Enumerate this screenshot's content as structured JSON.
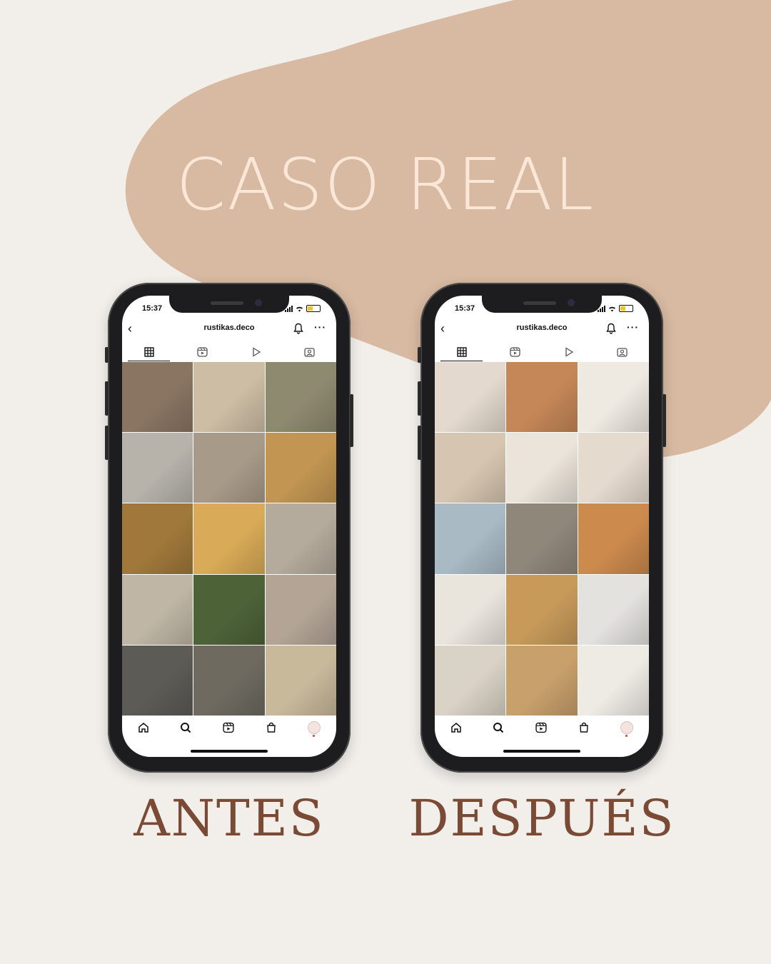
{
  "headline": "CASO REAL",
  "colors": {
    "background": "#f2efeb",
    "blob": "#d8b9a1",
    "headline": "#fbe7d8",
    "label": "#7a4a35"
  },
  "phones": [
    {
      "caption": "ANTES",
      "status_time": "15:37",
      "profile_name": "rustikas.deco",
      "icons": [
        "back-icon",
        "bell-icon",
        "more-icon",
        "grid-icon",
        "reels-icon",
        "play-icon",
        "tagged-icon",
        "home-icon",
        "search-icon",
        "reels-icon",
        "shop-icon",
        "profile-avatar"
      ],
      "tiles": [
        "#8a7563",
        "#cdbda4",
        "#8e8a70",
        "#b7b3ab",
        "#a89a88",
        "#c29652",
        "#a0783b",
        "#d9ab58",
        "#b5ab9c",
        "#bfb6a5",
        "#4e6238",
        "#b3a496",
        "#5c5b56",
        "#6e6a60",
        "#c9b99b"
      ]
    },
    {
      "caption": "DESPUÉS",
      "status_time": "15:37",
      "profile_name": "rustikas.deco",
      "icons": [
        "back-icon",
        "bell-icon",
        "more-icon",
        "grid-icon",
        "reels-icon",
        "play-icon",
        "tagged-icon",
        "home-icon",
        "search-icon",
        "reels-icon",
        "shop-icon",
        "profile-avatar"
      ],
      "tiles": [
        "#e3d9ce",
        "#c58758",
        "#eee9e1",
        "#d6c5b0",
        "#eae4da",
        "#e5dace",
        "#a9bac4",
        "#8f877a",
        "#cc8a4d",
        "#e9e4dc",
        "#c79a5a",
        "#e4e2df",
        "#d9d2c6",
        "#c8a06c",
        "#eeebe5"
      ]
    }
  ]
}
